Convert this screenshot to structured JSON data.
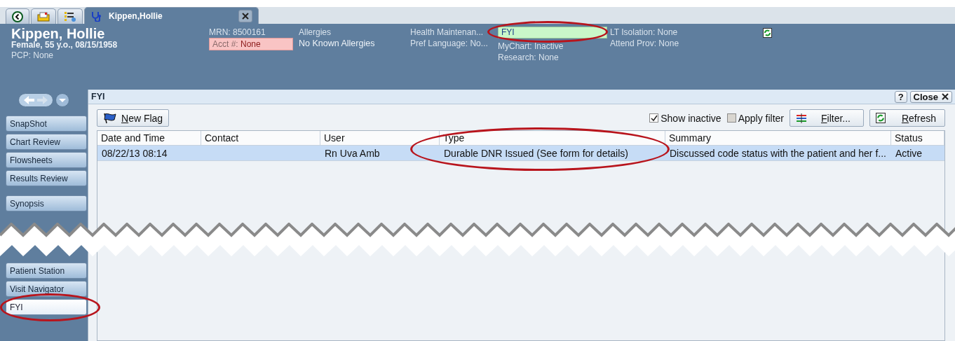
{
  "tabs": [
    {
      "kind": "back",
      "selected": false
    },
    {
      "kind": "inbox",
      "selected": false
    },
    {
      "kind": "list",
      "selected": false
    },
    {
      "kind": "patient",
      "label": "Kippen,Hollie",
      "selected": true
    }
  ],
  "patient": {
    "name": "Kippen, Hollie",
    "demographics": "Female, 55 y.o., 08/15/1958",
    "pcp": "PCP: None"
  },
  "header": {
    "mrn": "MRN: 8500161",
    "account": {
      "label": "Acct #:",
      "value": "None"
    },
    "allergies": {
      "label": "Allergies",
      "value": "No Known Allergies"
    },
    "health_maintenance": "Health Maintenan...",
    "pref_language": "Pref Language: No...",
    "fyi_field": {
      "value": "FYI"
    },
    "mychart": "MyChart: Inactive",
    "research": "Research: None",
    "isolation": "LT Isolation: None",
    "attend_prov": "Attend Prov: None"
  },
  "sidebar": {
    "top_groups": [
      {
        "items": [
          {
            "label": "SnapShot",
            "selected": false
          },
          {
            "label": "Chart Review",
            "selected": false
          },
          {
            "label": "Flowsheets",
            "selected": false
          },
          {
            "label": "Results Review",
            "selected": false
          }
        ]
      },
      {
        "items": [
          {
            "label": "Synopsis",
            "selected": false
          }
        ]
      }
    ],
    "bottom_groups": [
      {
        "items": [
          {
            "label": "Patient Station",
            "selected": false
          },
          {
            "label": "Visit Navigator",
            "selected": false
          },
          {
            "label": "FYI",
            "selected": true
          }
        ]
      }
    ]
  },
  "panel": {
    "title": "FYI",
    "help": "?",
    "close": "Close"
  },
  "toolbar": {
    "new_flag": "New Flag",
    "show_inactive": {
      "label": "Show inactive",
      "checked": true
    },
    "apply_filter": {
      "label": "Apply filter",
      "checked": false
    },
    "filter": "Filter...",
    "refresh": "Refresh"
  },
  "table": {
    "columns": [
      "Date and Time",
      "Contact",
      "User",
      "Type",
      "Summary",
      "Status"
    ],
    "rows": [
      {
        "selected": true,
        "cells": [
          "08/22/13 08:14",
          "",
          "Rn Uva Amb",
          "Durable DNR Issued (See form for details)",
          "Discussed code status with the patient and her f...",
          "Active"
        ]
      }
    ]
  },
  "annotation_ovals": [
    {
      "kind": "fyi-field"
    },
    {
      "kind": "type-column"
    },
    {
      "kind": "fyi-sidebar-item"
    }
  ]
}
